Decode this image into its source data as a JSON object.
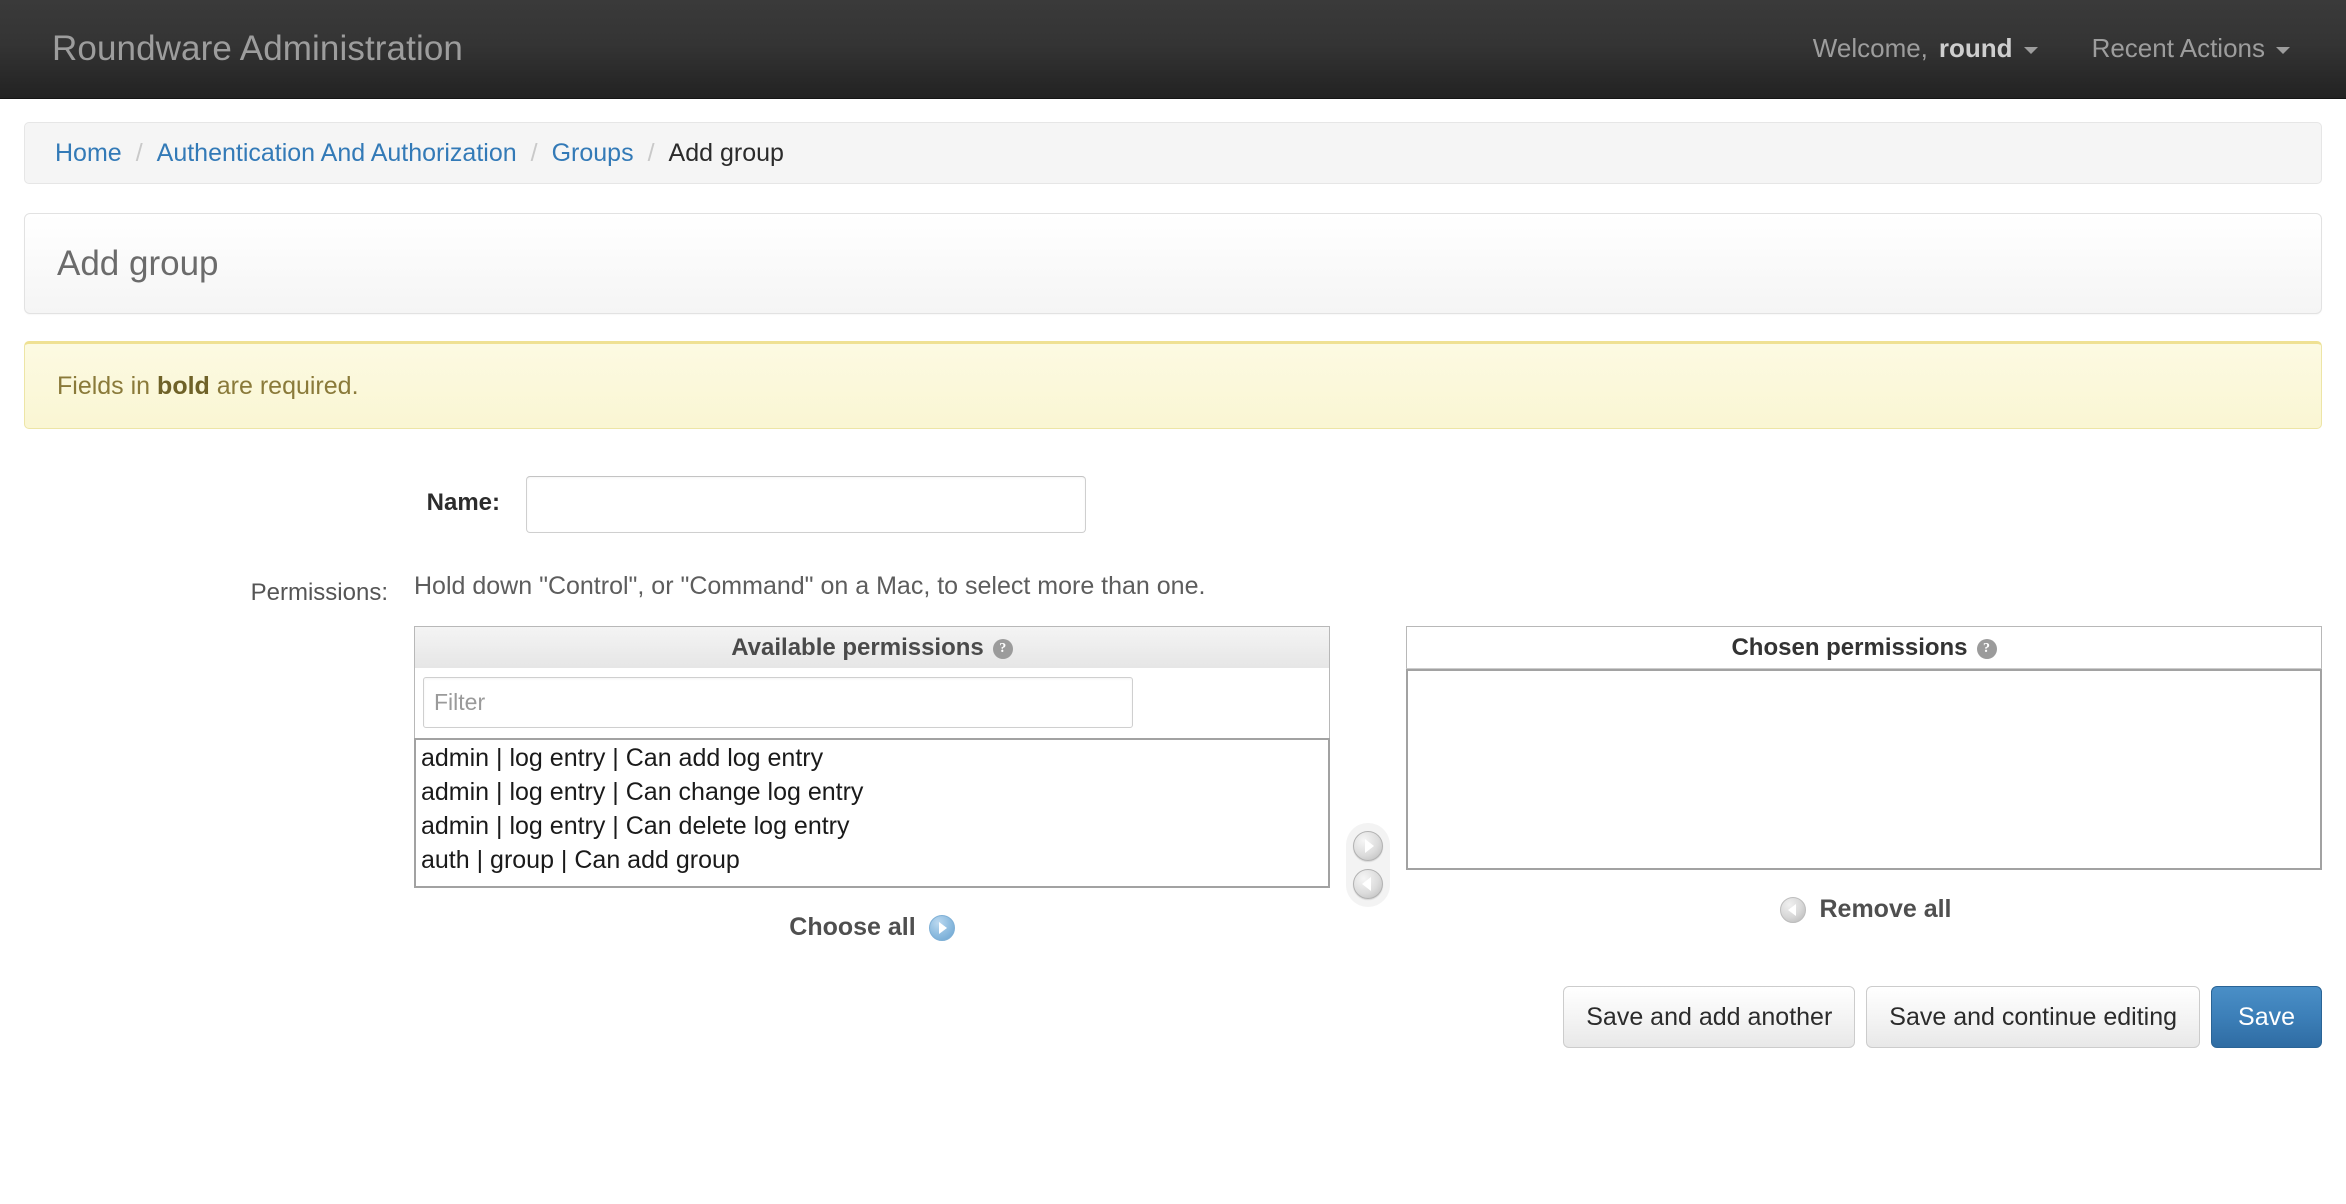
{
  "header": {
    "site_name": "Roundware Administration",
    "welcome_prefix": "Welcome,",
    "username": "round",
    "recent_actions_label": "Recent Actions"
  },
  "breadcrumbs": {
    "items": [
      {
        "label": "Home",
        "link": true
      },
      {
        "label": "Authentication And Authorization",
        "link": true
      },
      {
        "label": "Groups",
        "link": true
      },
      {
        "label": "Add group",
        "link": false
      }
    ],
    "separator": "/"
  },
  "page": {
    "title": "Add group"
  },
  "required_note": {
    "prefix": "Fields in",
    "bold": "bold",
    "suffix": "are required."
  },
  "form": {
    "name": {
      "label": "Name:",
      "value": "",
      "placeholder": ""
    },
    "permissions": {
      "label": "Permissions:",
      "help_text": "Hold down \"Control\", or \"Command\" on a Mac, to select more than one.",
      "available": {
        "title": "Available permissions",
        "help_icon_label": "?",
        "filter_placeholder": "Filter",
        "filter_value": "",
        "options": [
          "admin | log entry | Can add log entry",
          "admin | log entry | Can change log entry",
          "admin | log entry | Can delete log entry",
          "auth | group | Can add group"
        ],
        "action_label": "Choose all"
      },
      "chosen": {
        "title": "Chosen permissions",
        "help_icon_label": "?",
        "options": [],
        "action_label": "Remove all"
      },
      "chooser": {
        "add_label": "Choose",
        "remove_label": "Remove"
      }
    }
  },
  "submit_row": {
    "save_and_add_another": "Save and add another",
    "save_and_continue": "Save and continue editing",
    "save": "Save"
  },
  "colors": {
    "header_bg": "#333333",
    "link": "#337ab7",
    "primary_button": "#3c7fb8",
    "warning_bg": "#fcf8e3",
    "warning_border": "#efe193"
  }
}
